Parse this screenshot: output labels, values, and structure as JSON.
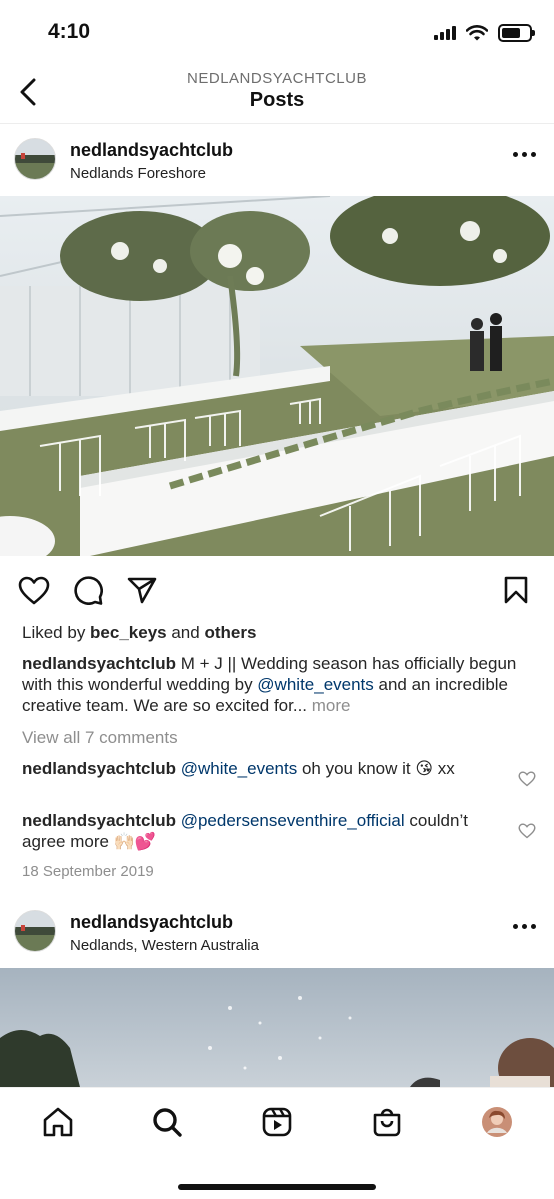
{
  "status_bar": {
    "time": "4:10",
    "icons": [
      "signal-icon",
      "wifi-icon",
      "battery-icon"
    ]
  },
  "header": {
    "account": "NEDLANDSYACHTCLUB",
    "title": "Posts",
    "back_icon": "chevron-left-icon"
  },
  "post1": {
    "username": "nedlandsyachtclub",
    "location": "Nedlands Foreshore",
    "likes": {
      "prefix": "Liked by ",
      "user": "bec_keys",
      "mid": " and ",
      "others": "others"
    },
    "caption": {
      "username": "nedlandsyachtclub",
      "text1": " M + J || Wedding season has officially begun with this wonderful wedding by ",
      "mention": "@white_events",
      "text2": " and an incredible creative team. We are so excited for...",
      "more": " more"
    },
    "view_comments": "View all 7 comments",
    "comments": [
      {
        "username": "nedlandsyachtclub",
        "mention": "@white_events",
        "text": " oh you know it 😘 xx"
      },
      {
        "username": "nedlandsyachtclub",
        "mention": "@pedersenseventhire_official",
        "text": " couldn’t agree more 🙌🏻💕"
      }
    ],
    "date": "18 September 2019"
  },
  "post2": {
    "username": "nedlandsyachtclub",
    "location": "Nedlands, Western Australia"
  },
  "bottom_nav": [
    "home-icon",
    "search-icon",
    "reels-icon",
    "shop-icon",
    "profile-avatar"
  ],
  "colors": {
    "mention": "#00376b",
    "muted": "#8e8e8e",
    "text": "#262626"
  }
}
